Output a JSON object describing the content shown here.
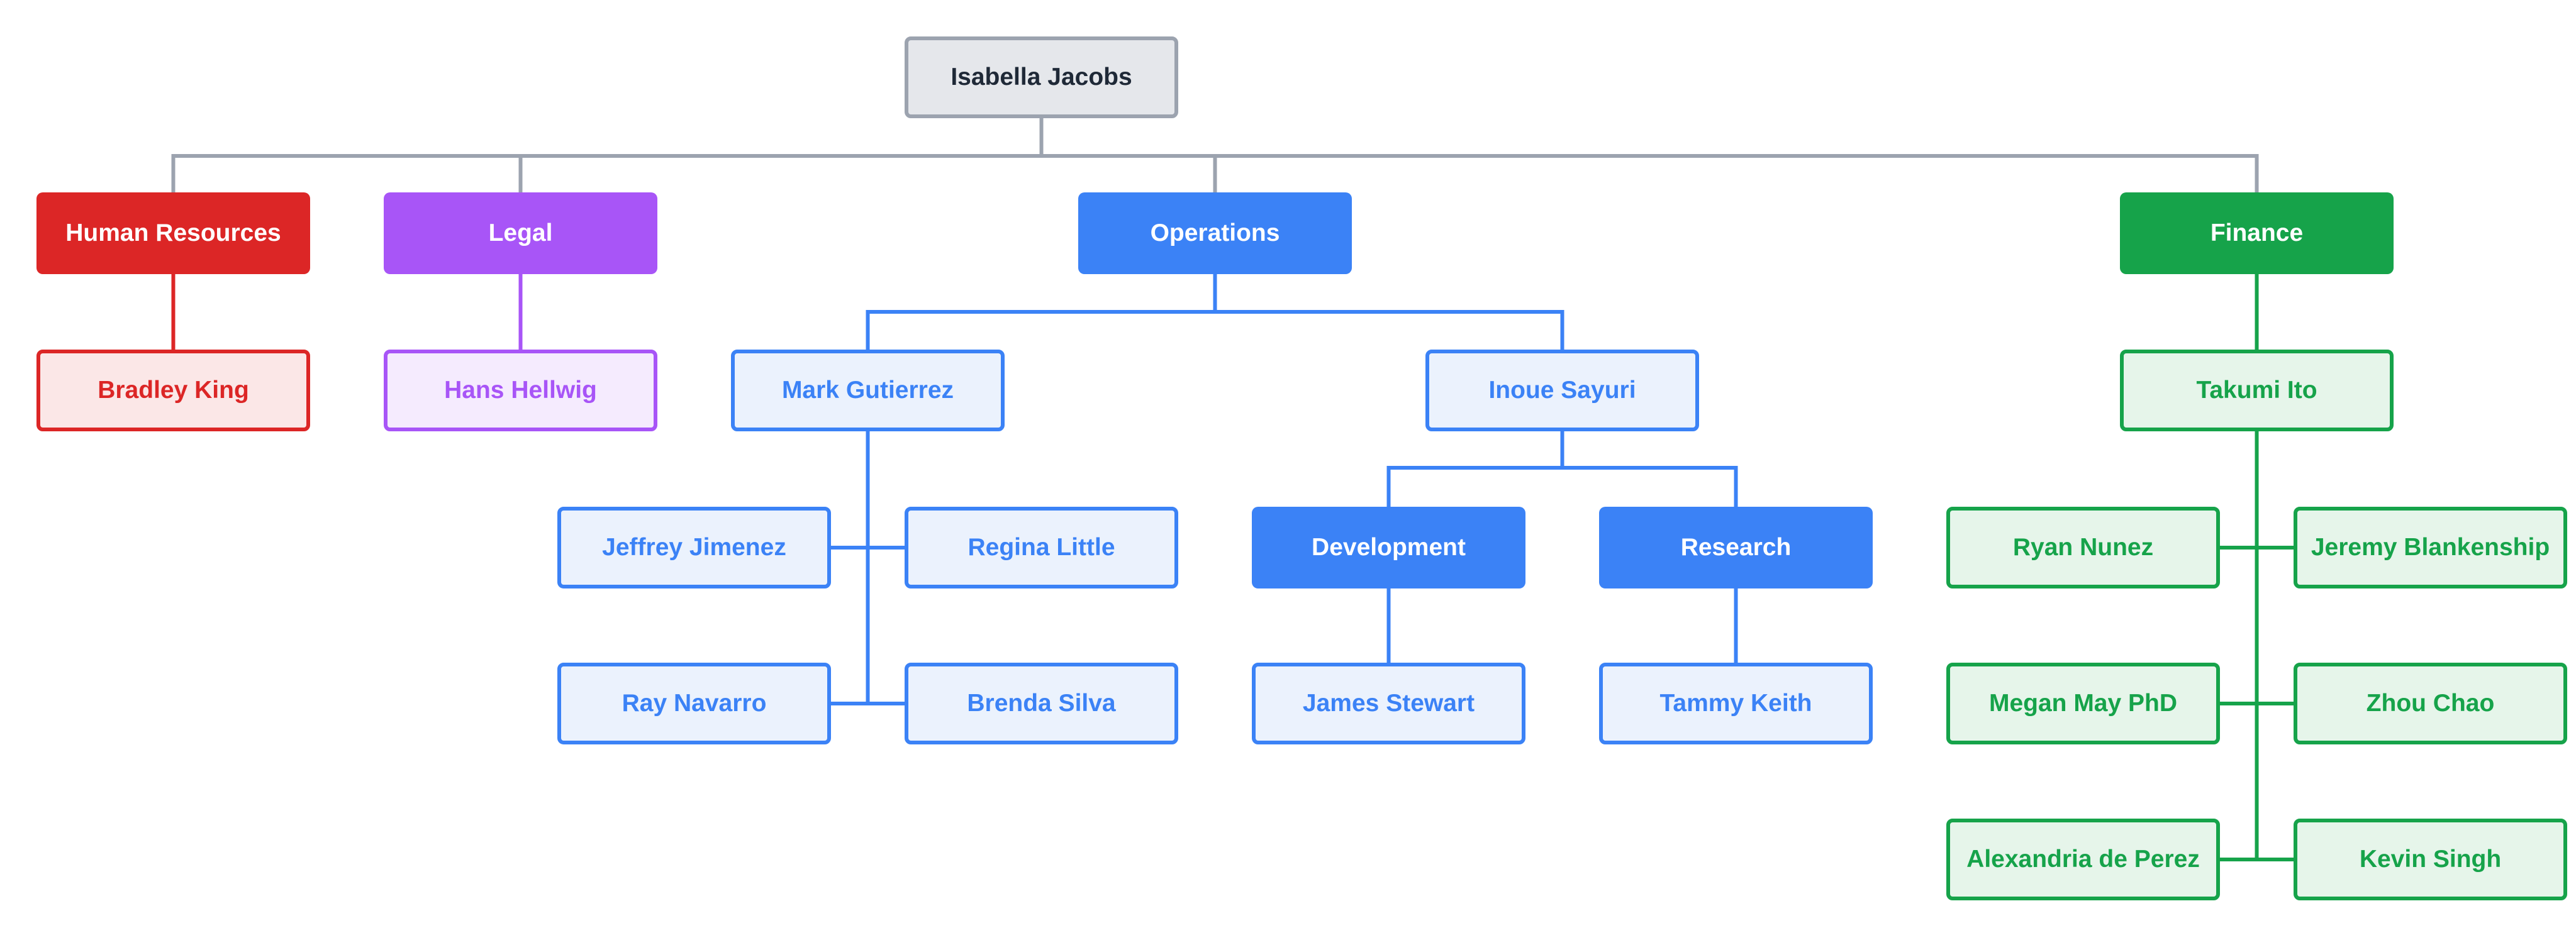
{
  "diagram": {
    "type": "org-chart",
    "palette": {
      "root": {
        "fill": "#e5e7eb",
        "stroke": "#9ca3af",
        "text": "#1f2937"
      },
      "hr": {
        "solid": "#dc2626",
        "light": "#fbe7e7"
      },
      "legal": {
        "solid": "#a855f7",
        "light": "#f5ebfe"
      },
      "ops": {
        "solid": "#3b82f6",
        "light": "#ebf2fd"
      },
      "finance": {
        "solid": "#16a34a",
        "light": "#e6f5ea"
      },
      "connector_root": "#9ca3af"
    },
    "root": {
      "id": "isabella",
      "label": "Isabella Jacobs"
    },
    "departments": [
      {
        "id": "hr",
        "label": "Human Resources",
        "color": "hr",
        "members": [
          {
            "id": "bradley",
            "label": "Bradley King"
          }
        ]
      },
      {
        "id": "legal",
        "label": "Legal",
        "color": "legal",
        "members": [
          {
            "id": "hans",
            "label": "Hans Hellwig"
          }
        ]
      },
      {
        "id": "ops",
        "label": "Operations",
        "color": "ops",
        "managers": [
          {
            "id": "mark",
            "label": "Mark Gutierrez",
            "reports": [
              {
                "id": "jeffrey",
                "label": "Jeffrey Jimenez"
              },
              {
                "id": "regina",
                "label": "Regina Little"
              },
              {
                "id": "ray",
                "label": "Ray Navarro"
              },
              {
                "id": "brenda",
                "label": "Brenda Silva"
              }
            ]
          },
          {
            "id": "inoue",
            "label": "Inoue Sayuri",
            "teams": [
              {
                "id": "dev",
                "label": "Development",
                "members": [
                  {
                    "id": "james",
                    "label": "James Stewart"
                  }
                ]
              },
              {
                "id": "research",
                "label": "Research",
                "members": [
                  {
                    "id": "tammy",
                    "label": "Tammy Keith"
                  }
                ]
              }
            ]
          }
        ]
      },
      {
        "id": "finance",
        "label": "Finance",
        "color": "finance",
        "managers": [
          {
            "id": "takumi",
            "label": "Takumi Ito",
            "reports": [
              {
                "id": "ryan",
                "label": "Ryan Nunez"
              },
              {
                "id": "jeremy",
                "label": "Jeremy Blankenship"
              },
              {
                "id": "megan",
                "label": "Megan May PhD"
              },
              {
                "id": "zhou",
                "label": "Zhou Chao"
              },
              {
                "id": "alexandria",
                "label": "Alexandria de Perez"
              },
              {
                "id": "kevin",
                "label": "Kevin Singh"
              }
            ]
          }
        ]
      }
    ]
  }
}
